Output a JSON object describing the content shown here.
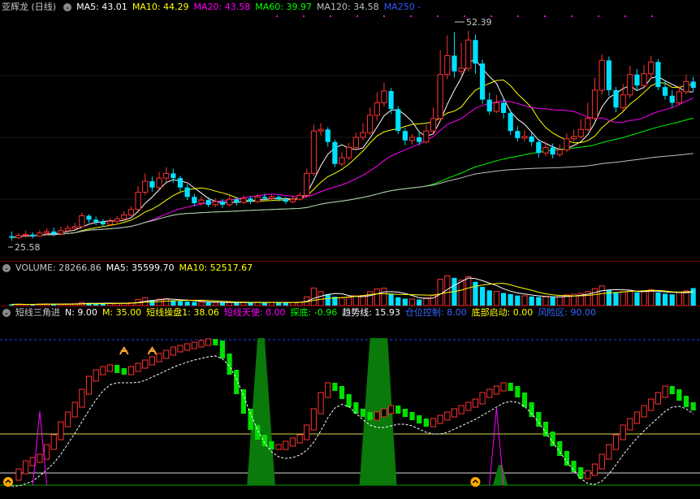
{
  "colors": {
    "bg": "#000000",
    "up": "#ff3232",
    "down": "#00e0ff",
    "ma5": "#ffffff",
    "ma10": "#ffff00",
    "ma20": "#ff00ff",
    "ma60": "#00ff00",
    "ma120": "#c0c0c0",
    "ma250": "#0000ff"
  },
  "price_panel": {
    "title": "亚辉龙 (日线)",
    "ma5_label": "MA5: 43.01",
    "ma10_label": "MA10: 44.29",
    "ma20_label": "MA20: 43.58",
    "ma60_label": "MA60: 39.97",
    "ma120_label": "MA120: 34.58",
    "ma250_label": "MA250 -",
    "high_marker": "52.39",
    "low_marker": "25.58"
  },
  "volume_panel": {
    "volume_label": "VOLUME: 28266.86",
    "ma5_label": "MA5: 35599.70",
    "ma10_label": "MA10: 52517.67"
  },
  "indicator_panel": {
    "name": "短线三角进",
    "n_label": "N: 9.00",
    "m_label": "M: 35.00",
    "op1_label": "短线操盘1: 38.06",
    "angel_label": "短线天使: 0.00",
    "bottom_label": "探底: -0.96",
    "trend_label": "趋势线: 15.93",
    "position_label": "仓位控制: 8.00",
    "start_label": "底部启动: 0.00",
    "risk_label": "风险区: 90.00"
  },
  "chart_data": [
    {
      "type": "candlestick",
      "title": "亚辉龙 (日线)",
      "price_high": 52.39,
      "price_low": 25.58,
      "candles": [
        [
          26.2,
          26.0,
          26.8,
          25.6
        ],
        [
          26.0,
          26.3,
          26.6,
          25.8
        ],
        [
          26.3,
          26.4,
          26.9,
          26.0
        ],
        [
          26.4,
          26.2,
          26.7,
          25.9
        ],
        [
          26.2,
          26.6,
          27.0,
          26.1
        ],
        [
          26.6,
          26.8,
          27.2,
          26.3
        ],
        [
          26.8,
          26.5,
          27.3,
          26.2
        ],
        [
          26.5,
          26.9,
          27.4,
          26.3
        ],
        [
          26.9,
          27.2,
          27.6,
          26.7
        ],
        [
          27.2,
          27.4,
          27.9,
          27.0
        ],
        [
          27.4,
          28.8,
          29.2,
          27.3
        ],
        [
          28.8,
          28.3,
          29.0,
          27.9
        ],
        [
          28.3,
          28.0,
          28.7,
          27.6
        ],
        [
          28.0,
          27.7,
          28.4,
          27.4
        ],
        [
          27.7,
          28.1,
          28.5,
          27.5
        ],
        [
          28.1,
          28.4,
          28.8,
          27.9
        ],
        [
          28.4,
          28.9,
          29.4,
          28.2
        ],
        [
          28.9,
          29.6,
          30.0,
          28.7
        ],
        [
          29.6,
          31.8,
          32.6,
          29.4
        ],
        [
          31.8,
          33.2,
          34.2,
          31.4
        ],
        [
          33.2,
          32.4,
          33.8,
          31.9
        ],
        [
          32.4,
          33.6,
          34.4,
          32.2
        ],
        [
          33.6,
          34.2,
          35.0,
          33.1
        ],
        [
          34.2,
          33.6,
          34.8,
          33.0
        ],
        [
          33.6,
          32.4,
          33.9,
          31.9
        ],
        [
          32.4,
          31.2,
          32.8,
          30.8
        ],
        [
          31.2,
          30.4,
          31.6,
          30.0
        ],
        [
          30.4,
          30.8,
          31.3,
          30.1
        ],
        [
          30.8,
          30.2,
          31.2,
          29.9
        ],
        [
          30.2,
          30.6,
          31.0,
          29.9
        ],
        [
          30.6,
          30.2,
          30.9,
          29.8
        ],
        [
          30.2,
          30.9,
          31.3,
          30.0
        ],
        [
          30.9,
          30.5,
          31.2,
          30.1
        ],
        [
          30.5,
          31.0,
          31.4,
          30.3
        ],
        [
          31.0,
          30.6,
          31.3,
          30.3
        ],
        [
          30.6,
          31.2,
          31.6,
          30.4
        ],
        [
          31.2,
          31.0,
          31.6,
          30.7
        ],
        [
          31.0,
          31.2,
          31.5,
          30.8
        ],
        [
          31.2,
          30.9,
          31.4,
          30.6
        ],
        [
          30.9,
          30.6,
          31.2,
          30.3
        ],
        [
          30.6,
          30.9,
          31.3,
          30.4
        ],
        [
          30.9,
          31.4,
          31.8,
          30.7
        ],
        [
          31.4,
          34.2,
          34.8,
          31.2
        ],
        [
          34.2,
          39.6,
          40.4,
          33.9
        ],
        [
          39.6,
          39.8,
          40.6,
          39.0
        ],
        [
          39.8,
          38.2,
          40.1,
          37.6
        ],
        [
          38.2,
          35.4,
          38.5,
          35.0
        ],
        [
          35.4,
          36.2,
          36.9,
          35.1
        ],
        [
          36.2,
          37.5,
          38.1,
          35.9
        ],
        [
          37.5,
          38.8,
          39.4,
          37.2
        ],
        [
          38.8,
          39.4,
          40.6,
          38.4
        ],
        [
          39.4,
          41.6,
          42.6,
          39.1
        ],
        [
          41.6,
          43.2,
          44.5,
          40.9
        ],
        [
          43.2,
          44.7,
          45.8,
          42.7
        ],
        [
          44.7,
          42.4,
          45.1,
          41.8
        ],
        [
          42.4,
          39.6,
          42.8,
          39.2
        ],
        [
          39.6,
          38.4,
          40.0,
          37.8
        ],
        [
          38.4,
          38.8,
          39.2,
          37.9
        ],
        [
          38.8,
          38.2,
          39.6,
          37.8
        ],
        [
          38.2,
          39.6,
          40.4,
          38.0
        ],
        [
          39.6,
          41.2,
          42.6,
          39.3
        ],
        [
          41.2,
          46.8,
          49.9,
          40.9
        ],
        [
          46.8,
          49.2,
          51.8,
          46.2
        ],
        [
          49.2,
          47.2,
          52.2,
          46.4
        ],
        [
          47.2,
          47.6,
          50.8,
          46.7
        ],
        [
          47.6,
          51.2,
          52.39,
          47.2
        ],
        [
          51.2,
          48.2,
          51.9,
          46.9
        ],
        [
          48.2,
          43.6,
          48.7,
          43.1
        ],
        [
          43.6,
          42.1,
          44.5,
          41.7
        ],
        [
          42.1,
          43.2,
          44.2,
          41.9
        ],
        [
          43.2,
          41.9,
          43.9,
          41.2
        ],
        [
          41.9,
          39.6,
          42.3,
          39.1
        ],
        [
          39.6,
          38.7,
          40.2,
          38.3
        ],
        [
          38.7,
          38.9,
          39.7,
          38.2
        ],
        [
          38.9,
          38.2,
          39.4,
          37.7
        ],
        [
          38.2,
          36.8,
          38.6,
          36.2
        ],
        [
          36.8,
          37.5,
          38.2,
          36.4
        ],
        [
          37.5,
          36.6,
          38.0,
          36.1
        ],
        [
          36.6,
          37.2,
          37.9,
          36.3
        ],
        [
          37.2,
          38.6,
          39.3,
          36.9
        ],
        [
          38.6,
          38.9,
          39.8,
          38.3
        ],
        [
          38.9,
          39.8,
          41.1,
          38.6
        ],
        [
          39.8,
          41.2,
          43.2,
          39.5
        ],
        [
          41.2,
          44.8,
          46.4,
          40.9
        ],
        [
          44.8,
          48.6,
          49.4,
          44.2
        ],
        [
          48.6,
          44.8,
          49.1,
          44.1
        ],
        [
          44.8,
          42.6,
          45.2,
          42.0
        ],
        [
          42.6,
          44.2,
          45.6,
          42.2
        ],
        [
          44.2,
          46.8,
          47.9,
          43.8
        ],
        [
          46.8,
          45.4,
          47.5,
          44.9
        ],
        [
          45.4,
          46.9,
          48.0,
          45.0
        ],
        [
          46.9,
          48.4,
          49.2,
          46.2
        ],
        [
          48.4,
          45.2,
          48.8,
          44.8
        ],
        [
          45.2,
          44.1,
          46.0,
          43.6
        ],
        [
          44.1,
          43.2,
          44.8,
          42.7
        ],
        [
          43.2,
          44.6,
          45.3,
          42.9
        ],
        [
          44.6,
          45.9,
          46.8,
          44.3
        ],
        [
          45.9,
          45.1,
          46.5,
          44.6
        ]
      ],
      "ma": {
        "MA5": 43.01,
        "MA10": 44.29,
        "MA20": 43.58,
        "MA60": 39.97,
        "MA120": 34.58
      }
    },
    {
      "type": "bar",
      "title": "VOLUME",
      "values": [
        2000,
        2200,
        1800,
        2100,
        2400,
        2600,
        2300,
        2500,
        2700,
        3000,
        5200,
        4200,
        3600,
        3400,
        3500,
        3800,
        4100,
        4600,
        9800,
        12600,
        9200,
        10400,
        11200,
        8600,
        7200,
        6400,
        5800,
        5600,
        5200,
        5000,
        4800,
        5100,
        4700,
        5300,
        4900,
        5500,
        5200,
        5400,
        5000,
        4800,
        5100,
        5600,
        14200,
        28400,
        22600,
        18400,
        14200,
        12400,
        13200,
        15800,
        16400,
        22400,
        26800,
        28200,
        18600,
        13400,
        11200,
        10400,
        9800,
        12600,
        16400,
        42600,
        48200,
        44800,
        41200,
        46800,
        38400,
        30200,
        24600,
        22800,
        20400,
        18600,
        16200,
        15800,
        14600,
        13800,
        14200,
        13600,
        14400,
        17200,
        18400,
        19800,
        22600,
        27400,
        31800,
        25400,
        20800,
        22400,
        24600,
        21200,
        23800,
        25600,
        21400,
        19200,
        18200,
        21600,
        23800,
        28266
      ]
    },
    {
      "type": "line",
      "title": "短线三角进",
      "values": [
        5,
        9,
        14,
        16,
        18,
        24,
        30,
        38,
        44,
        50,
        58,
        66,
        70,
        72,
        73,
        71,
        70,
        72,
        74,
        76,
        78,
        80,
        82,
        84,
        85,
        86,
        87,
        88,
        89,
        88,
        80,
        70,
        58,
        46,
        36,
        30,
        26,
        24,
        24,
        26,
        28,
        30,
        36,
        46,
        56,
        62,
        60,
        55,
        50,
        46,
        44,
        42,
        44,
        46,
        48,
        46,
        44,
        42,
        40,
        38,
        40,
        42,
        44,
        46,
        48,
        50,
        52,
        56,
        58,
        60,
        62,
        60,
        56,
        50,
        44,
        38,
        32,
        26,
        20,
        14,
        10,
        6,
        8,
        12,
        18,
        24,
        30,
        36,
        40,
        44,
        48,
        52,
        56,
        60,
        58,
        54,
        50,
        48
      ],
      "trend_line": 15.93,
      "risk_level": 90
    }
  ]
}
